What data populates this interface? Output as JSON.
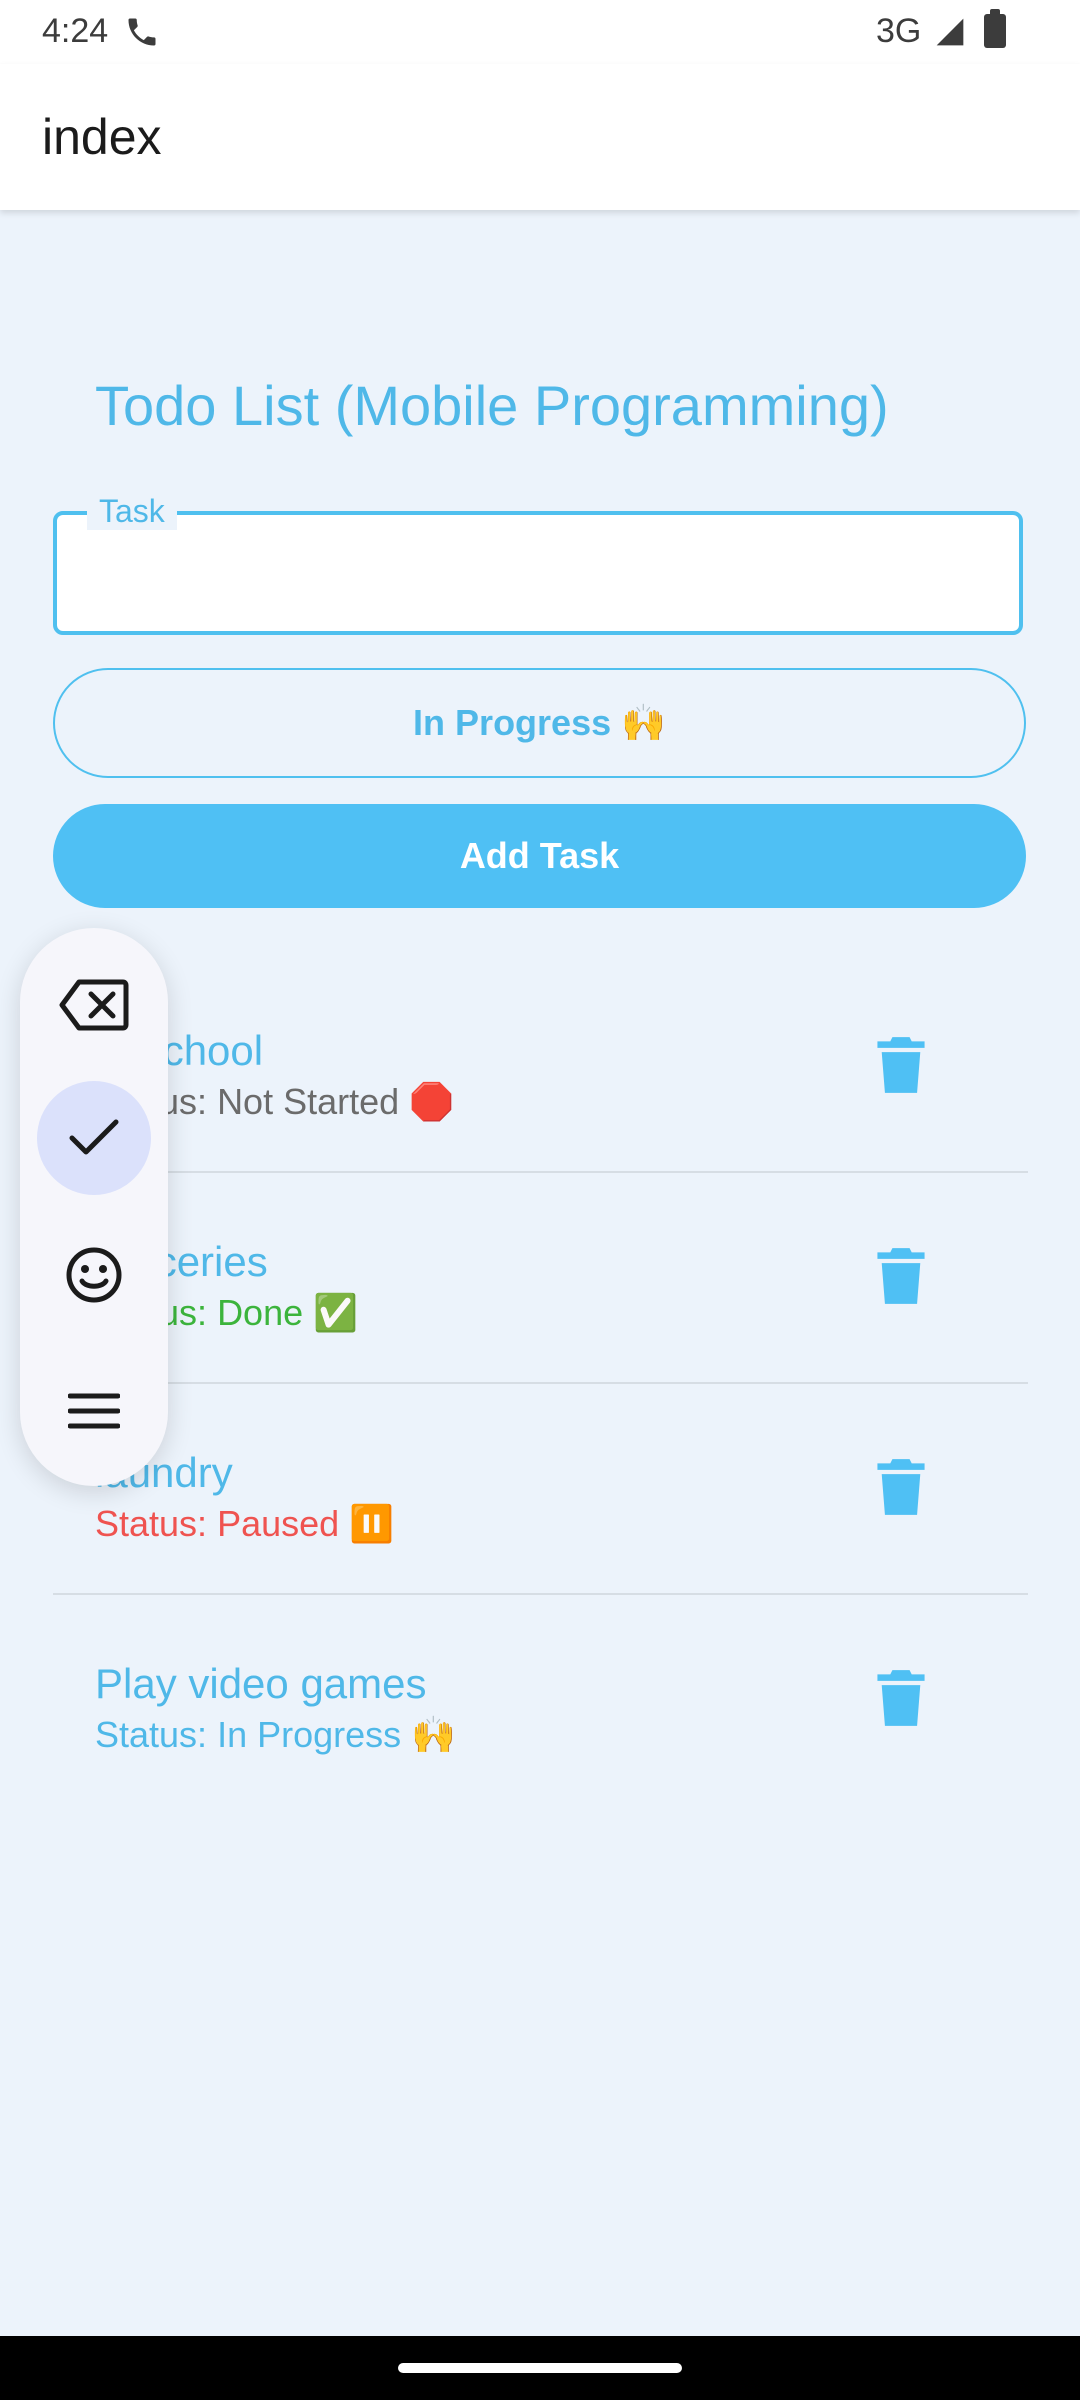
{
  "status_bar": {
    "time": "4:24",
    "network": "3G"
  },
  "app_bar": {
    "title": "index"
  },
  "heading": "Todo List (Mobile Programming)",
  "task_input": {
    "label": "Task",
    "value": ""
  },
  "status_selector": {
    "label": "In Progress 🙌"
  },
  "add_button": {
    "label": "Add Task"
  },
  "tasks": [
    {
      "name": "to school",
      "status": "Status: Not Started 🛑",
      "status_color": "#6b6b6b"
    },
    {
      "name": "groceries",
      "status": "Status: Done ✅",
      "status_color": "#3cb43c"
    },
    {
      "name": "laundry",
      "status": "Status: Paused ⏸️",
      "status_color": "#ef5350"
    },
    {
      "name": "Play video games",
      "status": "Status: In Progress 🙌",
      "status_color": "#4fb8e8"
    }
  ],
  "keyboard_menu": {
    "icons": [
      "backspace-icon",
      "check-icon",
      "emoji-icon",
      "menu-icon"
    ],
    "active": "check-icon"
  },
  "colors": {
    "accent": "#4fc0f4",
    "background": "#ecf3fb"
  }
}
